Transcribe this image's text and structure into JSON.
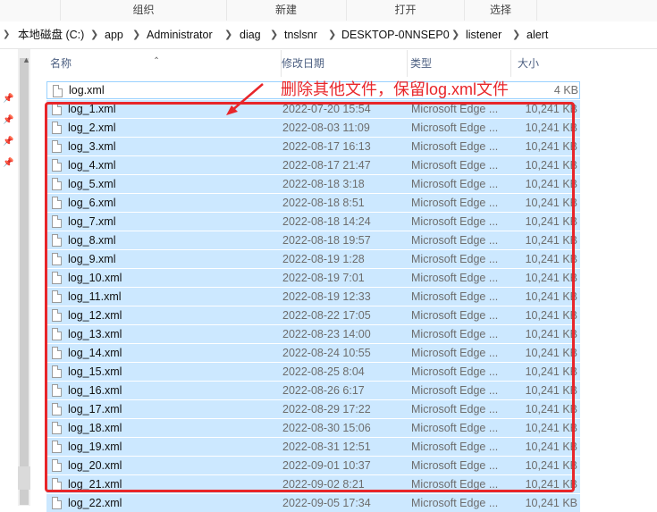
{
  "ribbon": {
    "groups": [
      "组织",
      "新建",
      "打开",
      "选择"
    ]
  },
  "address": {
    "crumbs": [
      "本地磁盘 (C:)",
      "app",
      "Administrator",
      "diag",
      "tnslsnr",
      "DESKTOP-0NNSEP0",
      "listener",
      "alert"
    ]
  },
  "columns": {
    "name": "名称",
    "modified": "修改日期",
    "type": "类型",
    "size": "大小"
  },
  "files": [
    {
      "name": "log.xml",
      "date": "",
      "type": "",
      "size": "4 KB",
      "selected": false
    },
    {
      "name": "log_1.xml",
      "date": "2022-07-20 15:54",
      "type": "Microsoft Edge ...",
      "size": "10,241 KB",
      "selected": true
    },
    {
      "name": "log_2.xml",
      "date": "2022-08-03 11:09",
      "type": "Microsoft Edge ...",
      "size": "10,241 KB",
      "selected": true
    },
    {
      "name": "log_3.xml",
      "date": "2022-08-17 16:13",
      "type": "Microsoft Edge ...",
      "size": "10,241 KB",
      "selected": true
    },
    {
      "name": "log_4.xml",
      "date": "2022-08-17 21:47",
      "type": "Microsoft Edge ...",
      "size": "10,241 KB",
      "selected": true
    },
    {
      "name": "log_5.xml",
      "date": "2022-08-18 3:18",
      "type": "Microsoft Edge ...",
      "size": "10,241 KB",
      "selected": true
    },
    {
      "name": "log_6.xml",
      "date": "2022-08-18 8:51",
      "type": "Microsoft Edge ...",
      "size": "10,241 KB",
      "selected": true
    },
    {
      "name": "log_7.xml",
      "date": "2022-08-18 14:24",
      "type": "Microsoft Edge ...",
      "size": "10,241 KB",
      "selected": true
    },
    {
      "name": "log_8.xml",
      "date": "2022-08-18 19:57",
      "type": "Microsoft Edge ...",
      "size": "10,241 KB",
      "selected": true
    },
    {
      "name": "log_9.xml",
      "date": "2022-08-19 1:28",
      "type": "Microsoft Edge ...",
      "size": "10,241 KB",
      "selected": true
    },
    {
      "name": "log_10.xml",
      "date": "2022-08-19 7:01",
      "type": "Microsoft Edge ...",
      "size": "10,241 KB",
      "selected": true
    },
    {
      "name": "log_11.xml",
      "date": "2022-08-19 12:33",
      "type": "Microsoft Edge ...",
      "size": "10,241 KB",
      "selected": true
    },
    {
      "name": "log_12.xml",
      "date": "2022-08-22 17:05",
      "type": "Microsoft Edge ...",
      "size": "10,241 KB",
      "selected": true
    },
    {
      "name": "log_13.xml",
      "date": "2022-08-23 14:00",
      "type": "Microsoft Edge ...",
      "size": "10,241 KB",
      "selected": true
    },
    {
      "name": "log_14.xml",
      "date": "2022-08-24 10:55",
      "type": "Microsoft Edge ...",
      "size": "10,241 KB",
      "selected": true
    },
    {
      "name": "log_15.xml",
      "date": "2022-08-25 8:04",
      "type": "Microsoft Edge ...",
      "size": "10,241 KB",
      "selected": true
    },
    {
      "name": "log_16.xml",
      "date": "2022-08-26 6:17",
      "type": "Microsoft Edge ...",
      "size": "10,241 KB",
      "selected": true
    },
    {
      "name": "log_17.xml",
      "date": "2022-08-29 17:22",
      "type": "Microsoft Edge ...",
      "size": "10,241 KB",
      "selected": true
    },
    {
      "name": "log_18.xml",
      "date": "2022-08-30 15:06",
      "type": "Microsoft Edge ...",
      "size": "10,241 KB",
      "selected": true
    },
    {
      "name": "log_19.xml",
      "date": "2022-08-31 12:51",
      "type": "Microsoft Edge ...",
      "size": "10,241 KB",
      "selected": true
    },
    {
      "name": "log_20.xml",
      "date": "2022-09-01 10:37",
      "type": "Microsoft Edge ...",
      "size": "10,241 KB",
      "selected": true
    },
    {
      "name": "log_21.xml",
      "date": "2022-09-02 8:21",
      "type": "Microsoft Edge ...",
      "size": "10,241 KB",
      "selected": true
    },
    {
      "name": "log_22.xml",
      "date": "2022-09-05 17:34",
      "type": "Microsoft Edge ...",
      "size": "10,241 KB",
      "selected": true
    }
  ],
  "annotation": {
    "text": "删除其他文件，保留log.xml文件",
    "color": "#e8262a"
  },
  "colors": {
    "selection": "#cce8ff",
    "header_text": "#4d6082"
  }
}
